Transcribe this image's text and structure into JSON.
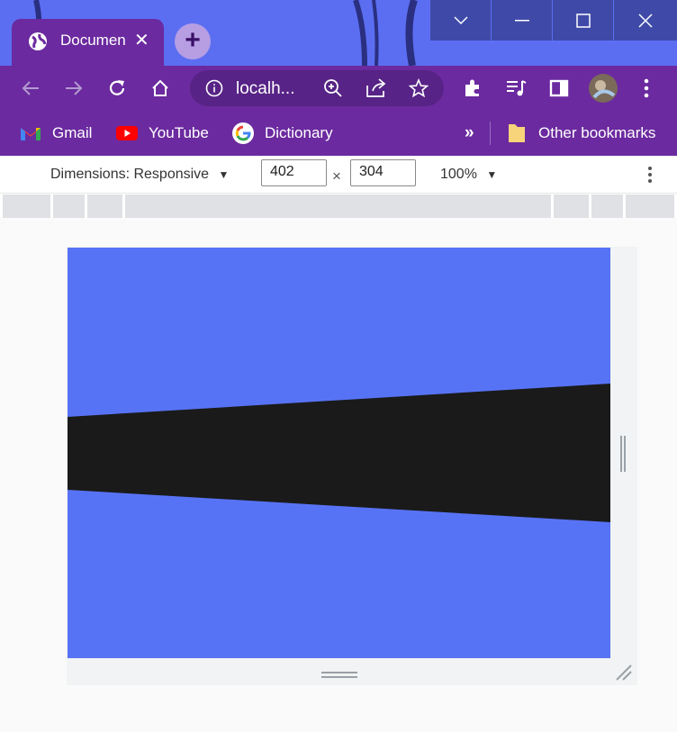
{
  "colors": {
    "wallpaper": "#5b6ef2",
    "browser_accent": "#6b2a9f",
    "page_background": "#5773f5",
    "page_stripe": "#1a1a1a"
  },
  "tab": {
    "title": "Document",
    "favicon": "globe-icon",
    "close": "✕"
  },
  "new_tab": {
    "label": "+"
  },
  "window_controls": {
    "search_tabs": "chevron-down-icon",
    "minimize": "minimize-icon",
    "maximize": "maximize-icon",
    "close": "close-icon"
  },
  "address_bar": {
    "url": "localh..."
  },
  "bookmarks": {
    "items": [
      {
        "label": "Gmail",
        "icon": "gmail-icon"
      },
      {
        "label": "YouTube",
        "icon": "youtube-icon"
      },
      {
        "label": "Dictionary",
        "icon": "google-icon"
      }
    ],
    "overflow": "»",
    "other": "Other bookmarks"
  },
  "device_toolbar": {
    "dimensions_label": "Dimensions: Responsive",
    "width": "402",
    "times": "×",
    "height": "304",
    "zoom": "100%"
  }
}
